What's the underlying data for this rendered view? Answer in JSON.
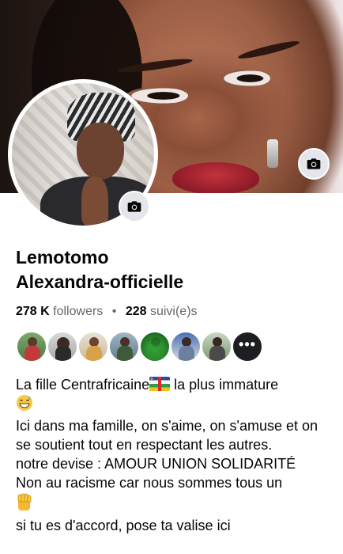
{
  "profile": {
    "name_line1": "Lemotomo",
    "name_line2": "Alexandra-officielle",
    "followers_count": "278 K",
    "followers_label": "followers",
    "separator": "•",
    "following_count": "228",
    "following_label": "suivi(e)s",
    "more_friends_label": "•••"
  },
  "bio": {
    "line1_before_flag": "La fille Centrafricaine",
    "line1_after_flag": " la plus immature",
    "line2": "Ici dans ma famille, on s'aime, on s'amuse et on se soutient tout en respectant les autres.",
    "line3": "notre devise : AMOUR UNION SOLIDARITÉ",
    "line4": "Non au racisme car nous sommes tous un",
    "line5": "si tu es d'accord, pose ta valise ici"
  },
  "icons": {
    "cover_camera": "camera-icon",
    "avatar_camera": "camera-icon",
    "flag": "central-african-republic-flag-icon",
    "emoji_sweat": "grinning-sweat-emoji-icon",
    "emoji_fist": "raised-fist-emoji-icon"
  },
  "colors": {
    "text_primary": "#050505",
    "text_secondary": "#65676b",
    "button_gray": "#e4e6eb"
  }
}
